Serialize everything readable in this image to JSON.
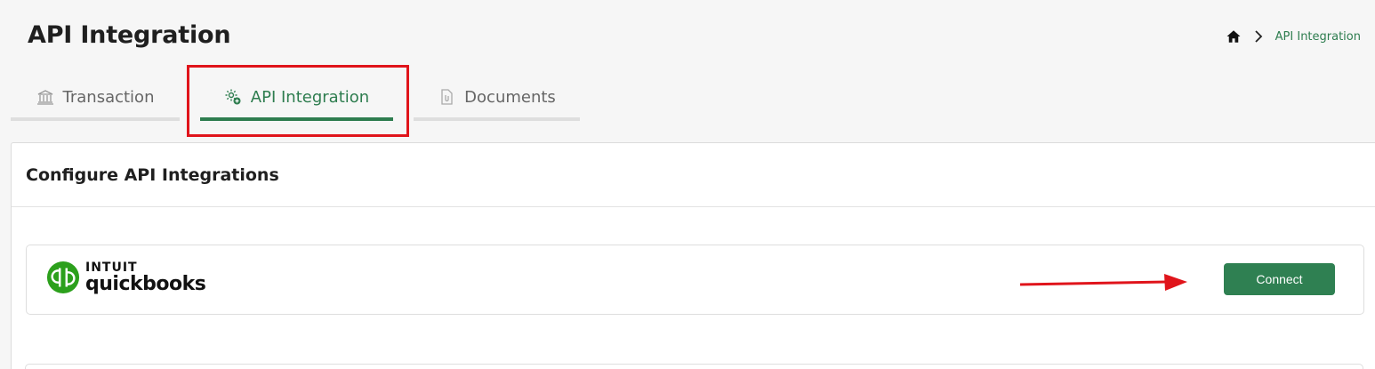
{
  "page": {
    "title": "API Integration"
  },
  "breadcrumb": {
    "home_icon": "home-icon",
    "separator_icon": "chevron-right-icon",
    "current": "API Integration"
  },
  "tabs": [
    {
      "label": "Transaction",
      "icon": "bank-icon",
      "active": false
    },
    {
      "label": "API Integration",
      "icon": "gear-plus-icon",
      "active": true
    },
    {
      "label": "Documents",
      "icon": "document-icon",
      "active": false
    }
  ],
  "card": {
    "title": "Configure API Integrations",
    "integrations": [
      {
        "logo_brand": "INTUIT",
        "logo_product": "quickbooks",
        "button_label": "Connect"
      }
    ]
  },
  "colors": {
    "accent": "#2e7d4f",
    "button": "#2f8052",
    "highlight": "#e0141b",
    "qb_green": "#2ca01c"
  }
}
